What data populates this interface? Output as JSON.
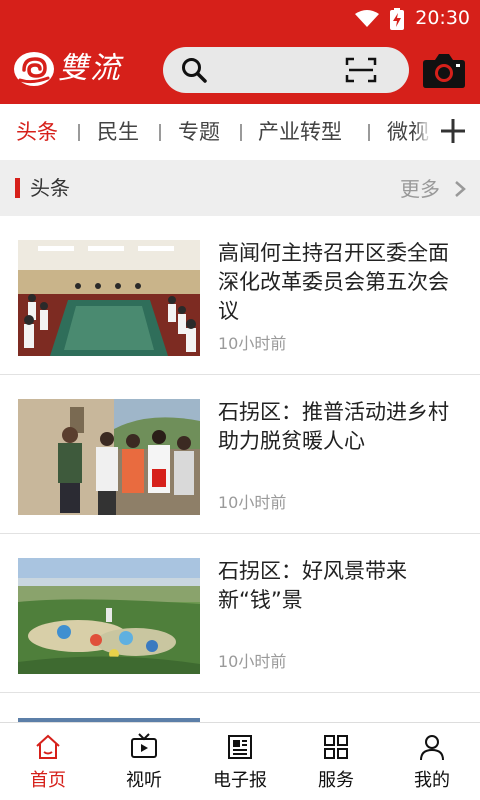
{
  "status_bar": {
    "time": "20:30",
    "icons": [
      "wifi-icon",
      "battery-charging-icon"
    ]
  },
  "header": {
    "logo_text": "雙流",
    "logo_icon": "swirl-logo-icon",
    "search_icon": "search-icon",
    "scan_icon": "scan-icon",
    "camera_icon": "camera-icon"
  },
  "tabs": {
    "items": [
      {
        "label": "头条",
        "active": true
      },
      {
        "label": "民生",
        "active": false
      },
      {
        "label": "专题",
        "active": false
      },
      {
        "label": "产业转型",
        "active": false
      },
      {
        "label": "微视",
        "active": false
      }
    ],
    "add_icon": "plus-icon"
  },
  "section": {
    "title": "头条",
    "more_label": "更多",
    "more_icon": "chevron-right-icon"
  },
  "news": [
    {
      "headline": "高闻何主持召开区委全面深化改革委员会第五次会议",
      "time": "10小时前",
      "thumb": "conference-meeting-photo"
    },
    {
      "headline": "石拐区：推普活动进乡村  助力脱贫暖人心",
      "time": "10小时前",
      "thumb": "village-volunteers-photo"
    },
    {
      "headline": "石拐区：好风景带来新“钱”景",
      "time": "10小时前",
      "thumb": "park-landscape-photo"
    }
  ],
  "bottom_nav": [
    {
      "label": "首页",
      "icon": "home-icon",
      "active": true
    },
    {
      "label": "视听",
      "icon": "tv-icon",
      "active": false
    },
    {
      "label": "电子报",
      "icon": "newspaper-icon",
      "active": false
    },
    {
      "label": "服务",
      "icon": "grid-icon",
      "active": false
    },
    {
      "label": "我的",
      "icon": "user-icon",
      "active": false
    }
  ],
  "colors": {
    "brand_red": "#d6201a",
    "section_bg": "#eeeeee",
    "muted": "#9a9a9a"
  }
}
